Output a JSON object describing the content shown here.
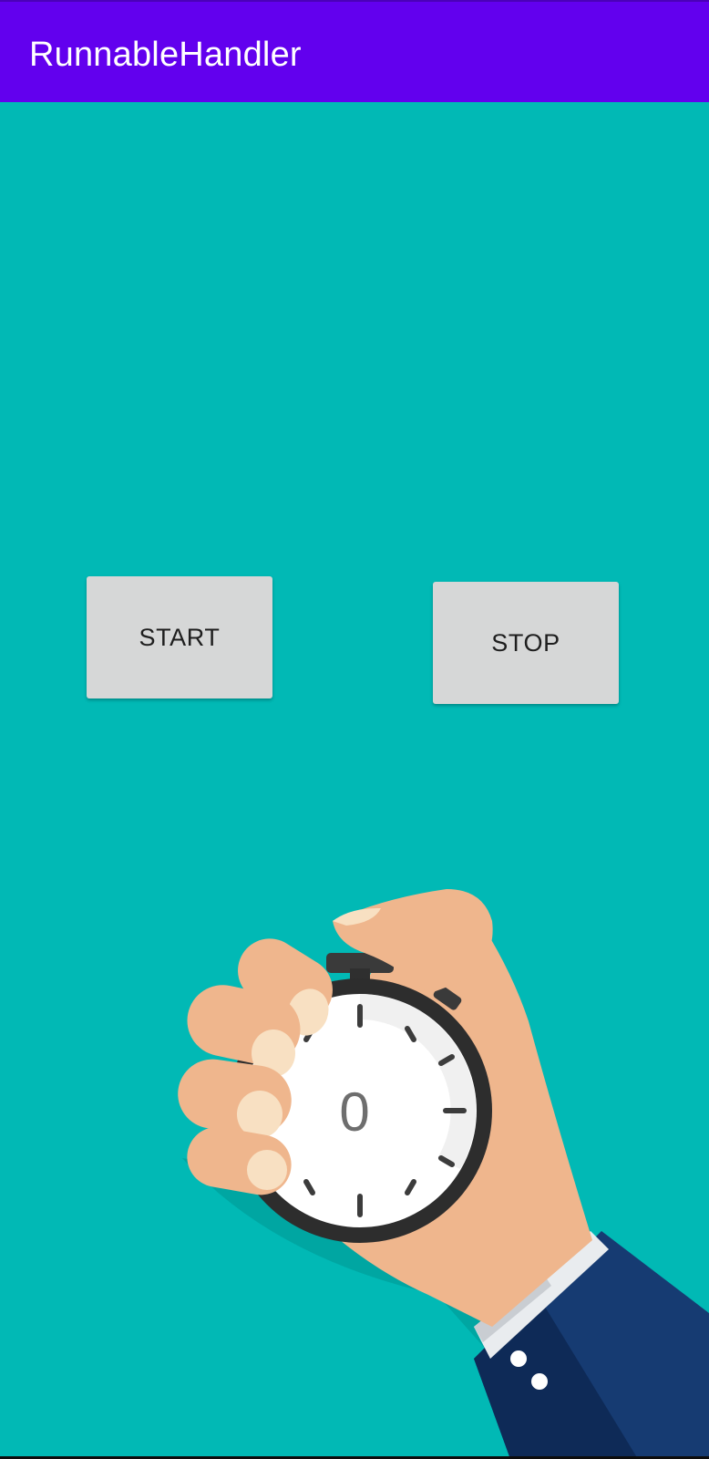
{
  "app_bar": {
    "title": "RunnableHandler",
    "color": "#6200ee"
  },
  "background_color": "#01b9b5",
  "controls": {
    "start_label": "START",
    "stop_label": "STOP"
  },
  "timer": {
    "value": "0"
  },
  "illustration": {
    "icon": "stopwatch-in-hand-illustration"
  }
}
